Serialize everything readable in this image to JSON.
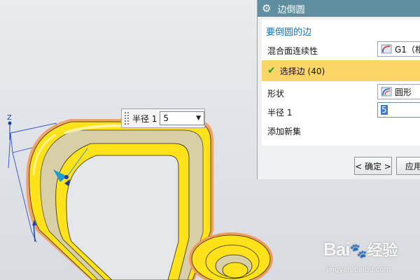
{
  "dialog": {
    "title": "边倒圆",
    "section_title": "要倒圆的边",
    "continuity_label": "混合面连续性",
    "continuity_value": "G1（相",
    "selected_edges": "选择边 (40)",
    "shape_label": "形状",
    "shape_value": "圆形",
    "radius_label": "半径 1",
    "radius_value": "5",
    "add_new_set": "添加新集",
    "ok_button": "< 确定 >",
    "apply_button": "应用"
  },
  "radius_popup": {
    "label": "半径 1",
    "value": "5"
  },
  "viewport": {
    "axis_label": "Z"
  },
  "watermark": {
    "brand": "Bai",
    "brand_suffix": "经验",
    "url": "jingyan.baidu.com"
  },
  "colors": {
    "title_bar": "#5f8ea0",
    "selected_row": "#fbd565",
    "accent_text": "#1d6fb0",
    "part_yellow": "#ffe21a",
    "part_inner": "#d9cfa6"
  }
}
